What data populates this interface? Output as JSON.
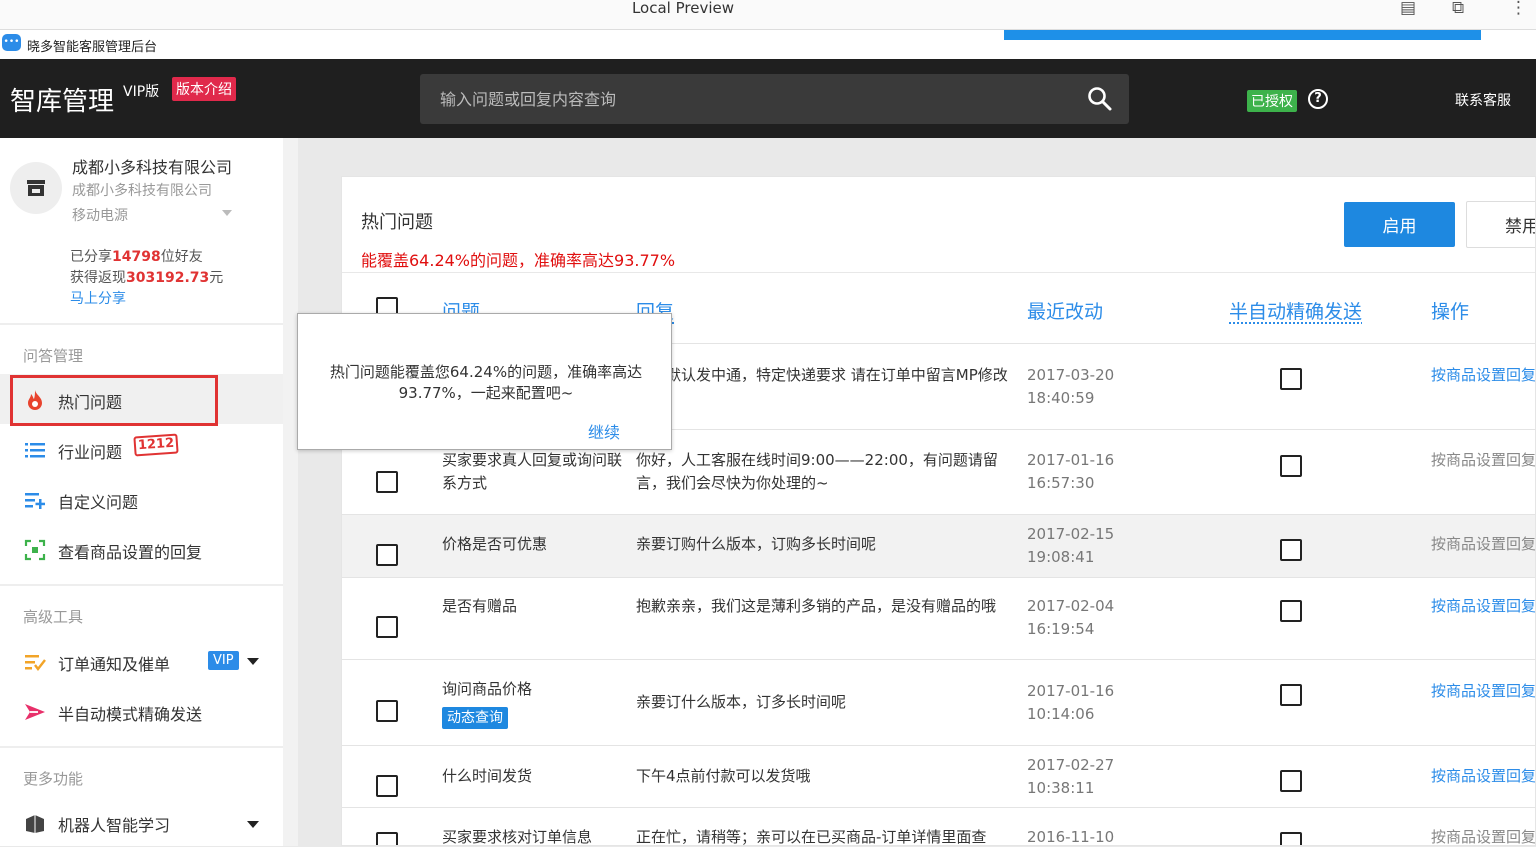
{
  "window": {
    "title": "Local Preview"
  },
  "tab": {
    "title": "晓多智能客服管理后台"
  },
  "header": {
    "brand": "智库管理",
    "vip_version": "VIP版",
    "version_intro": "版本介绍",
    "search_placeholder": "输入问题或回复内容查询",
    "authorized": "已授权",
    "contact": "联系客服"
  },
  "sidebar": {
    "company_name": "成都小多科技有限公司",
    "company_sub": "成都小多科技有限公司",
    "company_category": "移动电源",
    "share_prefix": "已分享",
    "share_count": "14798",
    "share_suffix": "位好友",
    "cash_prefix": "获得返现",
    "cash_amount": "303192.73",
    "cash_suffix": "元",
    "share_link": "马上分享",
    "groups": [
      {
        "title": "问答管理"
      },
      {
        "title": "高级工具"
      },
      {
        "title": "更多功能"
      }
    ],
    "items": [
      {
        "label": "热门问题",
        "icon": "fire-icon",
        "active": true
      },
      {
        "label": "行业问题",
        "icon": "list-icon",
        "badge": "1212"
      },
      {
        "label": "自定义问题",
        "icon": "list-add-icon"
      },
      {
        "label": "查看商品设置的回复",
        "icon": "scan-icon"
      },
      {
        "label": "订单通知及催单",
        "icon": "order-notify-icon",
        "badge": "VIP"
      },
      {
        "label": "半自动模式精确发送",
        "icon": "send-icon"
      },
      {
        "label": "机器人智能学习",
        "icon": "robot-icon"
      }
    ]
  },
  "main": {
    "title": "热门问题",
    "stat": "能覆盖64.24%的问题，准确率高达93.77%",
    "enable_button": "启用",
    "disable_button": "禁用",
    "columns": {
      "question": "问题",
      "reply": "回复",
      "last_modified": "最近改动",
      "semi_auto": "半自动精确发送",
      "action": "操作"
    },
    "rows": [
      {
        "question": "",
        "reply": "本店默认发中通，特定快递要求 请在订单中留言MP修改",
        "date": "2017-03-20",
        "time": "18:40:59",
        "action": "按商品设置回复"
      },
      {
        "question": "买家要求真人回复或询问联系方式",
        "reply": "你好，人工客服在线时间9:00——22:00，有问题请留言，我们会尽快为你处理的~",
        "date": "2017-01-16",
        "time": "16:57:30",
        "action": "按商品设置回复"
      },
      {
        "question": "价格是否可优惠",
        "reply": "亲要订购什么版本，订购多长时间呢",
        "date": "2017-02-15",
        "time": "19:08:41",
        "action": "按商品设置回复"
      },
      {
        "question": "是否有赠品",
        "reply": "抱歉亲亲，我们这是薄利多销的产品，是没有赠品的哦",
        "date": "2017-02-04",
        "time": "16:19:54",
        "action": "按商品设置回复"
      },
      {
        "question": "询问商品价格",
        "tag": "动态查询",
        "reply": "亲要订什么版本，订多长时间呢",
        "date": "2017-01-16",
        "time": "10:14:06",
        "action": "按商品设置回复"
      },
      {
        "question": "什么时间发货",
        "reply": "下午4点前付款可以发货哦",
        "date": "2017-02-27",
        "time": "10:38:11",
        "action": "按商品设置回复"
      },
      {
        "question": "买家要求核对订单信息",
        "reply": "正在忙，请稍等；亲可以在已买商品-订单详情里面查",
        "date": "2016-11-10",
        "time": "",
        "action": "按商品设置回复"
      }
    ]
  },
  "popover": {
    "text": "热门问题能覆盖您64.24%的问题，准确率高达93.77%，一起来配置吧~",
    "link": "继续"
  },
  "colors": {
    "accent": "#1e88e0",
    "danger": "#e00f0f",
    "header_bg": "#1f1f1f",
    "ok": "#3db24b"
  }
}
